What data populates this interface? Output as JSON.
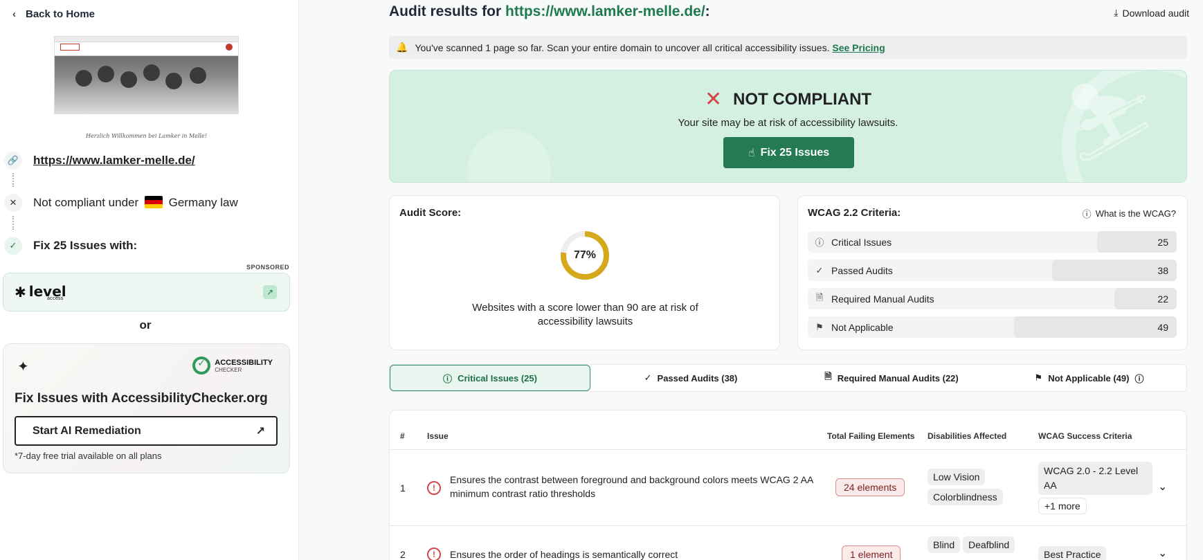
{
  "sidebar": {
    "back_label": "Back to Home",
    "caption": "Herzlich Willkommen bei Lamker in Melle!",
    "url": "https://www.lamker-melle.de/",
    "compliance_prefix": "Not compliant under",
    "compliance_law": "Germany law",
    "fix_label": "Fix 25 Issues with:",
    "sponsored": "SPONSORED",
    "level_logo": "level",
    "level_sub": "access",
    "or": "or",
    "ac_logo_line1": "ACCESSIBILITY",
    "ac_logo_line2": "CHECKER",
    "ac_title": "Fix Issues with AccessibilityChecker.org",
    "ai_button": "Start AI Remediation",
    "trial": "*7-day free trial available on all plans"
  },
  "header": {
    "title_prefix": "Audit results for",
    "url": "https://www.lamker-melle.de/",
    "title_suffix": ":",
    "download": "Download audit"
  },
  "notice": {
    "text": "You've scanned 1 page so far. Scan your entire domain to uncover all critical accessibility issues.",
    "link": "See Pricing"
  },
  "banner": {
    "status": "NOT COMPLIANT",
    "risk": "Your site may be at risk of accessibility lawsuits.",
    "fix_button": "Fix 25 Issues"
  },
  "score": {
    "title": "Audit Score:",
    "value": 77,
    "value_label": "77%",
    "note": "Websites with a score lower than 90 are at risk of accessibility lawsuits",
    "ring_color": "#d4a91c"
  },
  "wcag": {
    "title": "WCAG 2.2 Criteria:",
    "link": "What is the WCAG?",
    "rows": [
      {
        "label": "Critical Issues",
        "value": "25"
      },
      {
        "label": "Passed Audits",
        "value": "38"
      },
      {
        "label": "Required Manual Audits",
        "value": "22"
      },
      {
        "label": "Not Applicable",
        "value": "49"
      }
    ]
  },
  "tabs": [
    {
      "label": "Critical Issues (25)"
    },
    {
      "label": "Passed Audits (38)"
    },
    {
      "label": "Required Manual Audits (22)"
    },
    {
      "label": "Not Applicable (49)"
    }
  ],
  "table": {
    "headers": {
      "num": "#",
      "issue": "Issue",
      "failing": "Total Failing Elements",
      "disabilities": "Disabilities Affected",
      "criteria": "WCAG Success Criteria"
    },
    "rows": [
      {
        "num": "1",
        "issue": "Ensures the contrast between foreground and background colors meets WCAG 2 AA minimum contrast ratio thresholds",
        "failing": "24 elements",
        "disabilities": [
          "Low Vision",
          "Colorblindness"
        ],
        "criteria": "WCAG 2.0 - 2.2 Level AA",
        "more": "+1 more"
      },
      {
        "num": "2",
        "issue": "Ensures the order of headings is semantically correct",
        "failing": "1 element",
        "disabilities": [
          "Blind",
          "Deafblind"
        ],
        "criteria": "Best Practice"
      }
    ]
  }
}
